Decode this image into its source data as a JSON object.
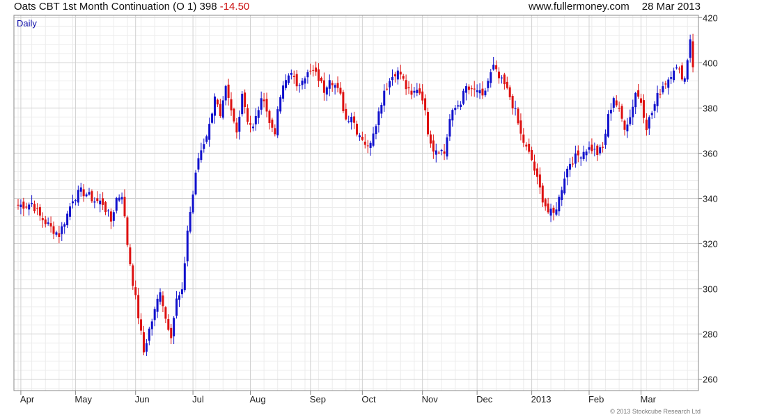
{
  "header": {
    "title": "Oats CBT 1st Month Continuation (O 1)",
    "last_price": "398",
    "change": "-14.50",
    "site": "www.fullermoney.com",
    "date": "28 Mar 2013"
  },
  "footer": {
    "copyright": "© 2013 Stockcube Research Ltd"
  },
  "colors": {
    "up": "#1111cc",
    "down": "#dd1111",
    "grid": "#d0d0d0",
    "grid_minor": "#ececec",
    "axis": "#888888"
  },
  "chart_data": {
    "type": "candlestick",
    "period_label": "Daily",
    "ylim": [
      255,
      421
    ],
    "y_ticks": [
      260,
      280,
      300,
      320,
      340,
      360,
      380,
      400,
      420
    ],
    "x_ticks": [
      {
        "index": 1,
        "label": "Apr"
      },
      {
        "index": 21,
        "label": "May"
      },
      {
        "index": 43,
        "label": "Jun"
      },
      {
        "index": 64,
        "label": "Jul"
      },
      {
        "index": 85,
        "label": "Aug"
      },
      {
        "index": 107,
        "label": "Sep"
      },
      {
        "index": 126,
        "label": "Oct"
      },
      {
        "index": 148,
        "label": "Nov"
      },
      {
        "index": 168,
        "label": "Dec"
      },
      {
        "index": 188,
        "label": "2013"
      },
      {
        "index": 209,
        "label": "Feb"
      },
      {
        "index": 228,
        "label": "Mar"
      }
    ],
    "x_range": [
      0,
      248
    ],
    "waypoints": [
      [
        0,
        337
      ],
      [
        3,
        337
      ],
      [
        5,
        338
      ],
      [
        8,
        332
      ],
      [
        12,
        327
      ],
      [
        15,
        324
      ],
      [
        18,
        333
      ],
      [
        20,
        340
      ],
      [
        23,
        343
      ],
      [
        25,
        342
      ],
      [
        28,
        339
      ],
      [
        31,
        338
      ],
      [
        34,
        330
      ],
      [
        36,
        340
      ],
      [
        38,
        342
      ],
      [
        40,
        320
      ],
      [
        42,
        303
      ],
      [
        44,
        288
      ],
      [
        46,
        272
      ],
      [
        48,
        282
      ],
      [
        50,
        290
      ],
      [
        52,
        300
      ],
      [
        54,
        287
      ],
      [
        56,
        280
      ],
      [
        58,
        295
      ],
      [
        60,
        298
      ],
      [
        62,
        326
      ],
      [
        64,
        342
      ],
      [
        66,
        358
      ],
      [
        68,
        365
      ],
      [
        70,
        372
      ],
      [
        72,
        386
      ],
      [
        74,
        375
      ],
      [
        76,
        388
      ],
      [
        78,
        378
      ],
      [
        80,
        369
      ],
      [
        82,
        387
      ],
      [
        84,
        375
      ],
      [
        86,
        371
      ],
      [
        88,
        380
      ],
      [
        90,
        385
      ],
      [
        92,
        373
      ],
      [
        94,
        370
      ],
      [
        96,
        385
      ],
      [
        98,
        392
      ],
      [
        100,
        397
      ],
      [
        102,
        388
      ],
      [
        104,
        394
      ],
      [
        106,
        395
      ],
      [
        108,
        396
      ],
      [
        110,
        393
      ],
      [
        112,
        388
      ],
      [
        114,
        394
      ],
      [
        116,
        390
      ],
      [
        118,
        385
      ],
      [
        120,
        375
      ],
      [
        122,
        377
      ],
      [
        124,
        370
      ],
      [
        126,
        367
      ],
      [
        128,
        362
      ],
      [
        130,
        370
      ],
      [
        132,
        378
      ],
      [
        134,
        388
      ],
      [
        136,
        392
      ],
      [
        138,
        396
      ],
      [
        140,
        395
      ],
      [
        142,
        389
      ],
      [
        144,
        385
      ],
      [
        146,
        389
      ],
      [
        148,
        385
      ],
      [
        150,
        370
      ],
      [
        152,
        362
      ],
      [
        154,
        362
      ],
      [
        156,
        360
      ],
      [
        158,
        375
      ],
      [
        160,
        380
      ],
      [
        162,
        383
      ],
      [
        164,
        389
      ],
      [
        166,
        387
      ],
      [
        168,
        388
      ],
      [
        170,
        384
      ],
      [
        172,
        392
      ],
      [
        174,
        398
      ],
      [
        176,
        393
      ],
      [
        178,
        390
      ],
      [
        180,
        385
      ],
      [
        182,
        378
      ],
      [
        184,
        368
      ],
      [
        186,
        362
      ],
      [
        188,
        357
      ],
      [
        190,
        348
      ],
      [
        192,
        340
      ],
      [
        194,
        334
      ],
      [
        196,
        333
      ],
      [
        198,
        340
      ],
      [
        200,
        350
      ],
      [
        202,
        356
      ],
      [
        204,
        358
      ],
      [
        206,
        360
      ],
      [
        208,
        362
      ],
      [
        210,
        362
      ],
      [
        212,
        360
      ],
      [
        214,
        362
      ],
      [
        216,
        376
      ],
      [
        218,
        385
      ],
      [
        220,
        378
      ],
      [
        222,
        372
      ],
      [
        224,
        376
      ],
      [
        226,
        387
      ],
      [
        228,
        383
      ],
      [
        230,
        372
      ],
      [
        232,
        378
      ],
      [
        234,
        385
      ],
      [
        236,
        390
      ],
      [
        238,
        393
      ],
      [
        240,
        398
      ],
      [
        242,
        396
      ],
      [
        244,
        393
      ],
      [
        246,
        411
      ],
      [
        247,
        398
      ]
    ]
  }
}
